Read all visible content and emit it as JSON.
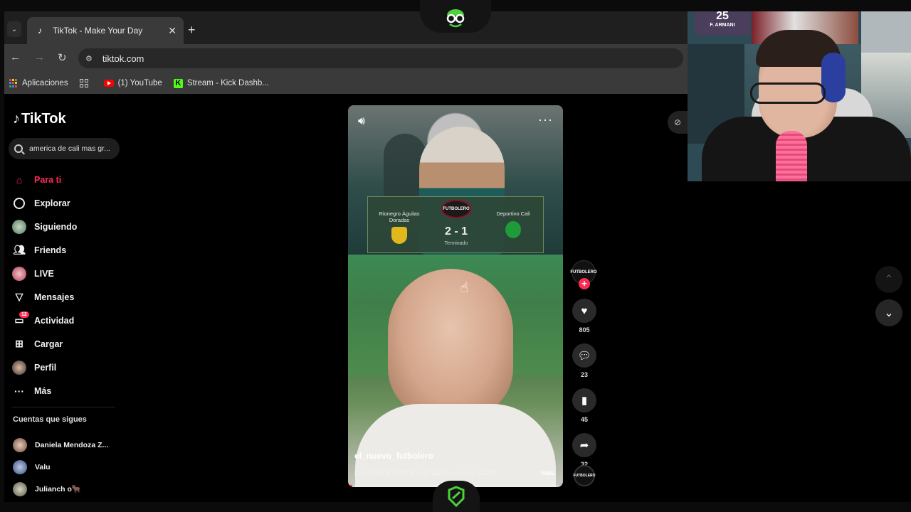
{
  "browser": {
    "tab_title": "TikTok - Make Your Day",
    "tab_close": "✕",
    "new_tab": "+",
    "url": "tiktok.com",
    "bookmarks": [
      {
        "label": "Aplicaciones",
        "icon": "apps-grid-icon"
      },
      {
        "label": "",
        "icon": "tab-groups-icon"
      },
      {
        "label": "(1) YouTube",
        "icon": "youtube-icon"
      },
      {
        "label": "Stream - Kick Dashb...",
        "icon": "kick-icon"
      }
    ]
  },
  "tiktok": {
    "logo": "TikTok",
    "search_value": "america de cali mas gr...",
    "nav": [
      {
        "label": "Para ti",
        "icon": "home-icon",
        "active": true
      },
      {
        "label": "Explorar",
        "icon": "compass-icon"
      },
      {
        "label": "Siguiendo",
        "icon": "following-avatar-icon"
      },
      {
        "label": "Friends",
        "icon": "friends-icon"
      },
      {
        "label": "LIVE",
        "icon": "live-avatar-icon"
      },
      {
        "label": "Mensajes",
        "icon": "send-icon"
      },
      {
        "label": "Actividad",
        "icon": "inbox-icon",
        "badge": "12"
      },
      {
        "label": "Cargar",
        "icon": "upload-icon"
      },
      {
        "label": "Perfil",
        "icon": "profile-avatar-icon"
      },
      {
        "label": "Más",
        "icon": "more-dots-icon"
      }
    ],
    "following_title": "Cuentas que sigues",
    "following": [
      {
        "name": "Daniela Mendoza Z..."
      },
      {
        "name": "Valu"
      },
      {
        "name": "Julianch o🐂"
      }
    ]
  },
  "video": {
    "scoreboard": {
      "home_team": "Rionegro Águilas Doradas",
      "away_team": "Deportivo Cali",
      "score": "2 - 1",
      "status": "Terminado",
      "brand": "FUTBOLERO"
    },
    "username": "el_nuevo_futbolero",
    "caption": "La situación del Cali está cada vez peor,  Carlos",
    "more": "más",
    "progress": 0.02
  },
  "actions": {
    "creator_brand": "FUTBOLERO",
    "likes": "805",
    "comments": "23",
    "saves": "45",
    "shares": "32"
  },
  "webcam": {
    "poster_text": "25",
    "poster_subtext": "F. ARMANI"
  },
  "colors": {
    "accent": "#fe2c55",
    "background": "#000000",
    "chrome_dark": "#1f1f1f",
    "chrome_mid": "#3a3a3a",
    "kick_green": "#53fc18"
  }
}
